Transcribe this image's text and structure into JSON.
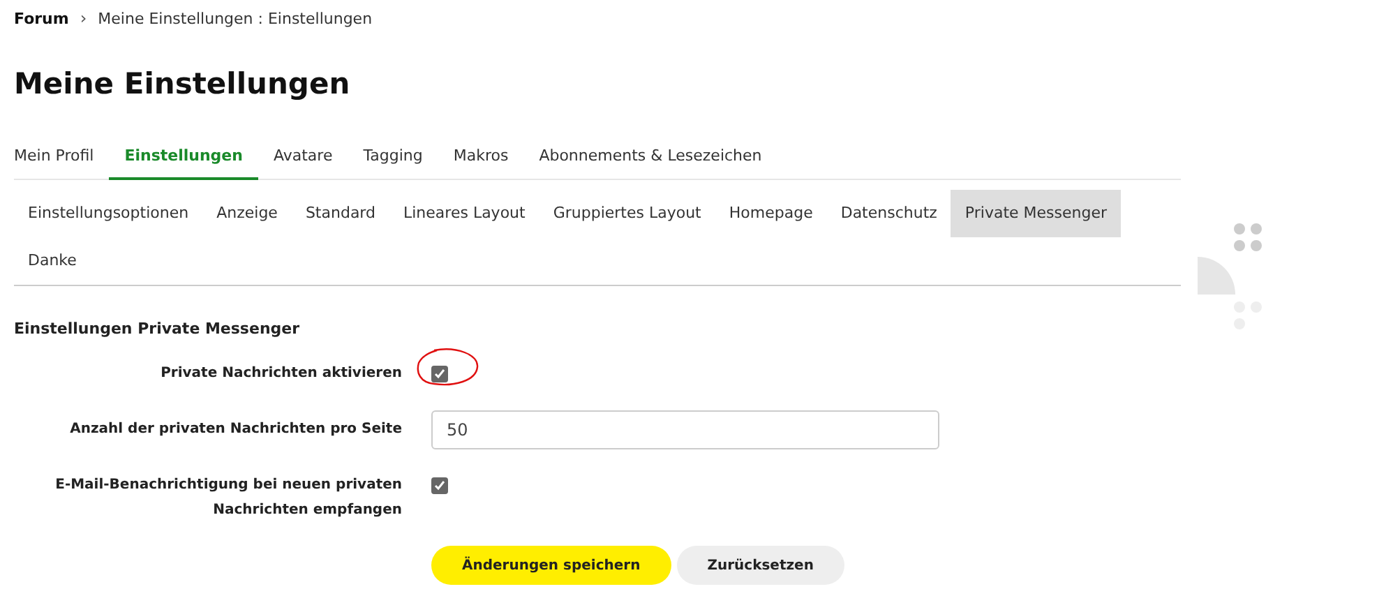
{
  "breadcrumb": {
    "root": "Forum",
    "separator": "›",
    "current": "Meine Einstellungen : Einstellungen"
  },
  "title": "Meine Einstellungen",
  "tabs": [
    {
      "label": "Mein Profil",
      "selected": false
    },
    {
      "label": "Einstellungen",
      "selected": true
    },
    {
      "label": "Avatare",
      "selected": false
    },
    {
      "label": "Tagging",
      "selected": false
    },
    {
      "label": "Makros",
      "selected": false
    },
    {
      "label": "Abonnements & Lesezeichen",
      "selected": false
    }
  ],
  "subtabs": [
    {
      "label": "Einstellungsoptionen",
      "selected": false
    },
    {
      "label": "Anzeige",
      "selected": false
    },
    {
      "label": "Standard",
      "selected": false
    },
    {
      "label": "Lineares Layout",
      "selected": false
    },
    {
      "label": "Gruppiertes Layout",
      "selected": false
    },
    {
      "label": "Homepage",
      "selected": false
    },
    {
      "label": "Datenschutz",
      "selected": false
    },
    {
      "label": "Private Messenger",
      "selected": true
    },
    {
      "label": "Danke",
      "selected": false
    }
  ],
  "section_title": "Einstellungen Private Messenger",
  "fields": [
    {
      "kind": "checkbox",
      "label": "Private Nachrichten aktivieren",
      "checked": true,
      "circled": true
    },
    {
      "kind": "text",
      "label": "Anzahl der privaten Nachrichten pro Seite",
      "value": "50"
    },
    {
      "kind": "checkbox",
      "label": "E-Mail-Benachrichtigung bei neuen privaten Nachrichten empfangen",
      "checked": true
    }
  ],
  "buttons": [
    {
      "label": "Änderungen speichern",
      "kind": "primary"
    },
    {
      "label": "Zurücksetzen",
      "kind": "secondary"
    }
  ]
}
